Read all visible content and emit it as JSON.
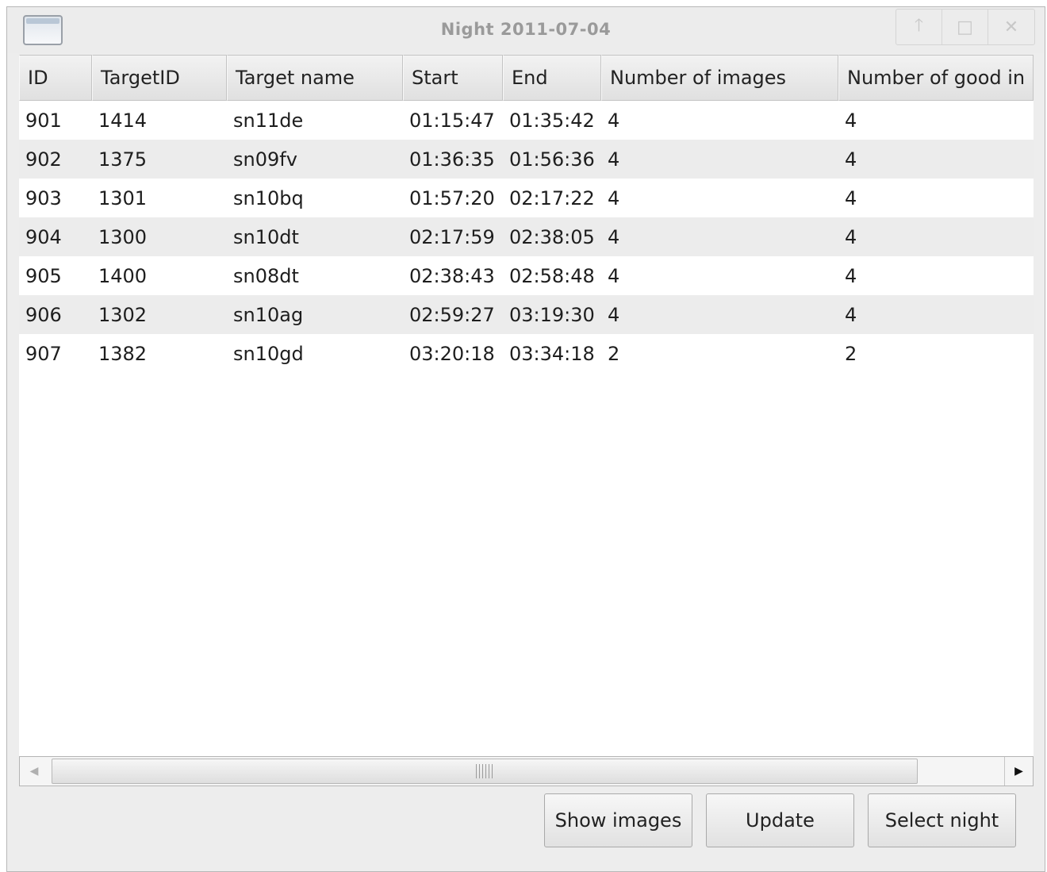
{
  "window": {
    "title": "Night 2011-07-04",
    "controls": {
      "minimize": "🡑",
      "maximize": "□",
      "close": "✕"
    }
  },
  "table": {
    "columns": [
      "ID",
      "TargetID",
      "Target name",
      "Start",
      "End",
      "Number of images",
      "Number of good in"
    ],
    "rows": [
      [
        "901",
        "1414",
        "sn11de",
        "01:15:47",
        "01:35:42",
        "4",
        "4"
      ],
      [
        "902",
        "1375",
        "sn09fv",
        "01:36:35",
        "01:56:36",
        "4",
        "4"
      ],
      [
        "903",
        "1301",
        "sn10bq",
        "01:57:20",
        "02:17:22",
        "4",
        "4"
      ],
      [
        "904",
        "1300",
        "sn10dt",
        "02:17:59",
        "02:38:05",
        "4",
        "4"
      ],
      [
        "905",
        "1400",
        "sn08dt",
        "02:38:43",
        "02:58:48",
        "4",
        "4"
      ],
      [
        "906",
        "1302",
        "sn10ag",
        "02:59:27",
        "03:19:30",
        "4",
        "4"
      ],
      [
        "907",
        "1382",
        "sn10gd",
        "03:20:18",
        "03:34:18",
        "2",
        "2"
      ]
    ]
  },
  "scrollbar": {
    "left_arrow": "◀",
    "right_arrow": "▶"
  },
  "buttons": {
    "show_images": "Show images",
    "update": "Update",
    "select_night": "Select night"
  }
}
